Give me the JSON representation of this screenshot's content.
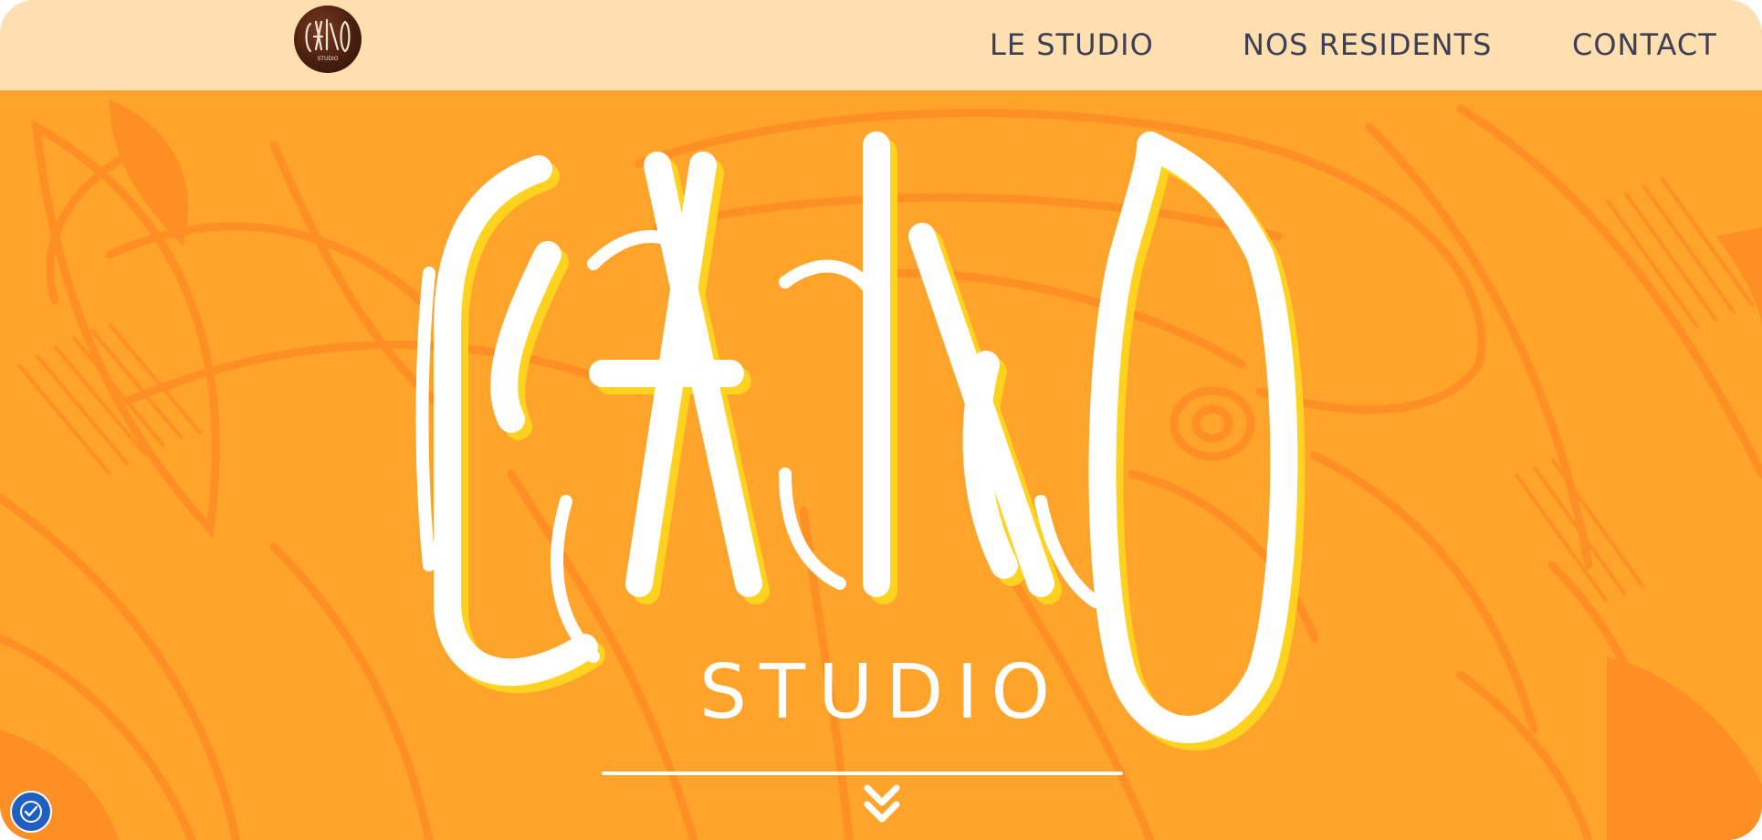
{
  "brand": {
    "logo_icon": "callao-studio-logo",
    "name": "CALLAO",
    "subtitle": "STUDIO"
  },
  "nav": {
    "items": [
      {
        "label": "LE STUDIO"
      },
      {
        "label": "NOS RESIDENTS"
      },
      {
        "label": "CONTACT"
      }
    ]
  },
  "hero": {
    "background": "orange illustrated toucan and leaves",
    "scroll_icon": "double-chevron-down-icon"
  },
  "accessibility": {
    "icon": "accessibility-icon"
  },
  "colors": {
    "topbar": "#fedfb0",
    "hero": "#fea42b",
    "hero_lines": "#fd8f25",
    "nav_text": "#3e3e55",
    "wordmark": "#ffffff",
    "wordmark_shadow": "#ffd21f",
    "a11y": "#1f5fc2"
  }
}
